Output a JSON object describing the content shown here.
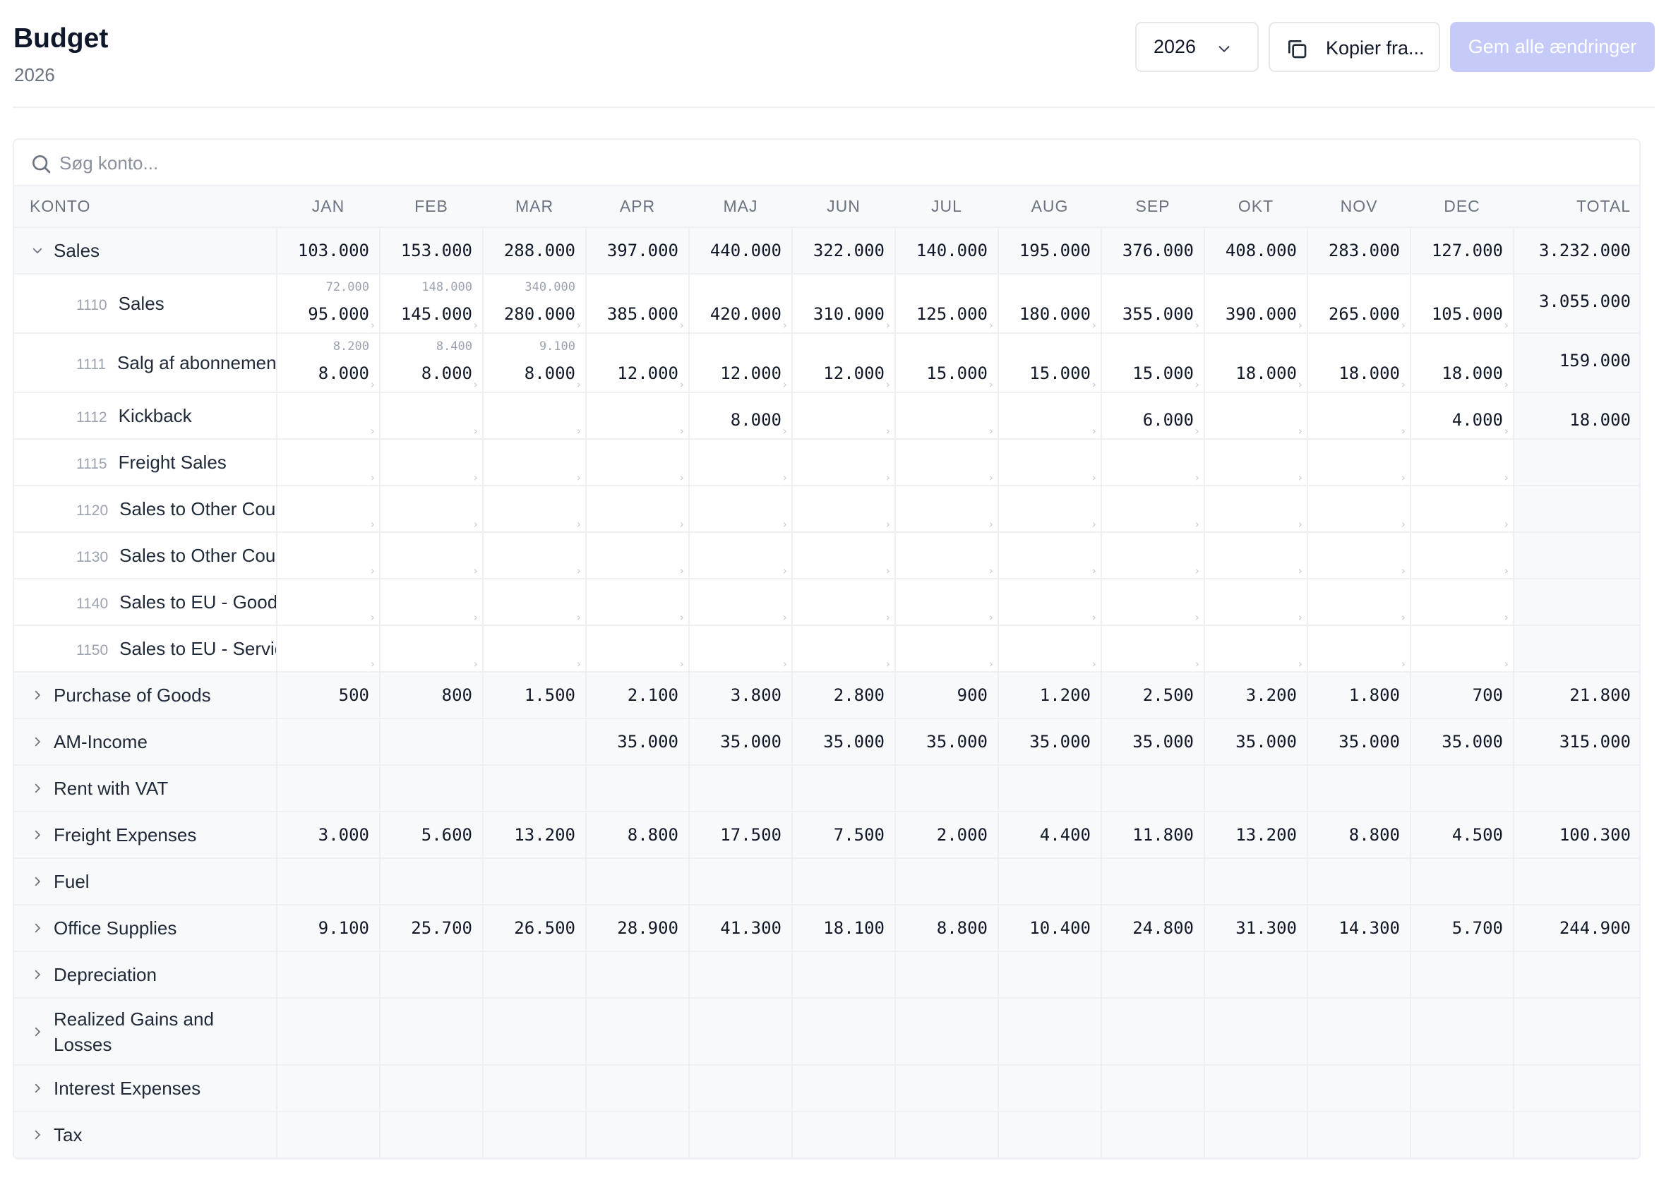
{
  "header": {
    "title": "Budget",
    "subtitle": "2026",
    "year_value": "2026",
    "copy_label": "Kopier fra...",
    "save_label": "Gem alle ændringer"
  },
  "search": {
    "placeholder": "Søg konto..."
  },
  "columns": [
    "KONTO",
    "JAN",
    "FEB",
    "MAR",
    "APR",
    "MAJ",
    "JUN",
    "JUL",
    "AUG",
    "SEP",
    "OKT",
    "NOV",
    "DEC",
    "TOTAL"
  ],
  "rows": [
    {
      "type": "group",
      "expanded": true,
      "name": "Sales",
      "values": [
        "103.000",
        "153.000",
        "288.000",
        "397.000",
        "440.000",
        "322.000",
        "140.000",
        "195.000",
        "376.000",
        "408.000",
        "283.000",
        "127.000"
      ],
      "total": "3.232.000"
    },
    {
      "type": "child",
      "tall": true,
      "code": "1110",
      "name": "Sales",
      "values": [
        "95.000",
        "145.000",
        "280.000",
        "385.000",
        "420.000",
        "310.000",
        "125.000",
        "180.000",
        "355.000",
        "390.000",
        "265.000",
        "105.000"
      ],
      "prev": [
        "72.000",
        "148.000",
        "340.000",
        "",
        "",
        "",
        "",
        "",
        "",
        "",
        "",
        ""
      ],
      "total": "3.055.000"
    },
    {
      "type": "child",
      "tall": true,
      "code": "1111",
      "name": "Salg af abonnement",
      "values": [
        "8.000",
        "8.000",
        "8.000",
        "12.000",
        "12.000",
        "12.000",
        "15.000",
        "15.000",
        "15.000",
        "18.000",
        "18.000",
        "18.000"
      ],
      "prev": [
        "8.200",
        "8.400",
        "9.100",
        "",
        "",
        "",
        "",
        "",
        "",
        "",
        "",
        ""
      ],
      "total": "159.000"
    },
    {
      "type": "child",
      "code": "1112",
      "name": "Kickback",
      "values": [
        "",
        "",
        "",
        "",
        "8.000",
        "",
        "",
        "",
        "6.000",
        "",
        "",
        "4.000"
      ],
      "total": "18.000"
    },
    {
      "type": "child",
      "code": "1115",
      "name": "Freight Sales",
      "values": [
        "",
        "",
        "",
        "",
        "",
        "",
        "",
        "",
        "",
        "",
        "",
        ""
      ],
      "total": ""
    },
    {
      "type": "child",
      "code": "1120",
      "name": "Sales to Other Countries",
      "values": [
        "",
        "",
        "",
        "",
        "",
        "",
        "",
        "",
        "",
        "",
        "",
        ""
      ],
      "total": ""
    },
    {
      "type": "child",
      "code": "1130",
      "name": "Sales to Other Countries",
      "values": [
        "",
        "",
        "",
        "",
        "",
        "",
        "",
        "",
        "",
        "",
        "",
        ""
      ],
      "total": ""
    },
    {
      "type": "child",
      "code": "1140",
      "name": "Sales to EU - Goods",
      "values": [
        "",
        "",
        "",
        "",
        "",
        "",
        "",
        "",
        "",
        "",
        "",
        ""
      ],
      "total": ""
    },
    {
      "type": "child",
      "code": "1150",
      "name": "Sales to EU - Services",
      "values": [
        "",
        "",
        "",
        "",
        "",
        "",
        "",
        "",
        "",
        "",
        "",
        ""
      ],
      "total": ""
    },
    {
      "type": "group",
      "name": "Purchase of Goods",
      "values": [
        "500",
        "800",
        "1.500",
        "2.100",
        "3.800",
        "2.800",
        "900",
        "1.200",
        "2.500",
        "3.200",
        "1.800",
        "700"
      ],
      "total": "21.800"
    },
    {
      "type": "group",
      "name": "AM-Income",
      "values": [
        "",
        "",
        "",
        "35.000",
        "35.000",
        "35.000",
        "35.000",
        "35.000",
        "35.000",
        "35.000",
        "35.000",
        "35.000"
      ],
      "total": "315.000"
    },
    {
      "type": "group",
      "name": "Rent with VAT",
      "values": [
        "",
        "",
        "",
        "",
        "",
        "",
        "",
        "",
        "",
        "",
        "",
        ""
      ],
      "total": ""
    },
    {
      "type": "group",
      "name": "Freight Expenses",
      "values": [
        "3.000",
        "5.600",
        "13.200",
        "8.800",
        "17.500",
        "7.500",
        "2.000",
        "4.400",
        "11.800",
        "13.200",
        "8.800",
        "4.500"
      ],
      "total": "100.300"
    },
    {
      "type": "group",
      "name": "Fuel",
      "values": [
        "",
        "",
        "",
        "",
        "",
        "",
        "",
        "",
        "",
        "",
        "",
        ""
      ],
      "total": ""
    },
    {
      "type": "group",
      "name": "Office Supplies",
      "values": [
        "9.100",
        "25.700",
        "26.500",
        "28.900",
        "41.300",
        "18.100",
        "8.800",
        "10.400",
        "24.800",
        "31.300",
        "14.300",
        "5.700"
      ],
      "total": "244.900"
    },
    {
      "type": "group",
      "name": "Depreciation",
      "values": [
        "",
        "",
        "",
        "",
        "",
        "",
        "",
        "",
        "",
        "",
        "",
        ""
      ],
      "total": ""
    },
    {
      "type": "group",
      "tall": true,
      "name": "Realized Gains and Losses",
      "values": [
        "",
        "",
        "",
        "",
        "",
        "",
        "",
        "",
        "",
        "",
        "",
        ""
      ],
      "total": ""
    },
    {
      "type": "group",
      "name": "Interest Expenses",
      "values": [
        "",
        "",
        "",
        "",
        "",
        "",
        "",
        "",
        "",
        "",
        "",
        ""
      ],
      "total": ""
    },
    {
      "type": "group",
      "name": "Tax",
      "values": [
        "",
        "",
        "",
        "",
        "",
        "",
        "",
        "",
        "",
        "",
        "",
        ""
      ],
      "total": ""
    }
  ]
}
